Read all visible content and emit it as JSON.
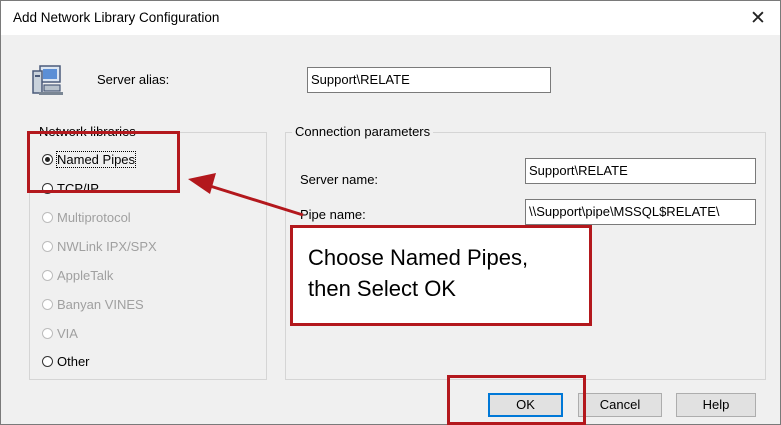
{
  "window": {
    "title": "Add Network Library Configuration",
    "close_glyph": "✕"
  },
  "alias": {
    "label": "Server alias:",
    "value": "Support\\RELATE",
    "icon": "server-computer-icon"
  },
  "libraries": {
    "caption": "Network libraries",
    "options": [
      {
        "label": "Named Pipes",
        "state": "checked"
      },
      {
        "label": "TCP/IP",
        "state": "enabled"
      },
      {
        "label": "Multiprotocol",
        "state": "disabled"
      },
      {
        "label": "NWLink IPX/SPX",
        "state": "disabled"
      },
      {
        "label": "AppleTalk",
        "state": "disabled"
      },
      {
        "label": "Banyan VINES",
        "state": "disabled"
      },
      {
        "label": "VIA",
        "state": "disabled"
      },
      {
        "label": "Other",
        "state": "enabled"
      }
    ]
  },
  "connection": {
    "caption": "Connection parameters",
    "server_name_label": "Server name:",
    "server_name_value": "Support\\RELATE",
    "pipe_name_label": "Pipe name:",
    "pipe_name_value": "\\\\Support\\pipe\\MSSQL$RELATE\\"
  },
  "annotation": {
    "line1": "Choose Named Pipes,",
    "line2": "then Select OK",
    "color": "#b3181d"
  },
  "buttons": {
    "ok": "OK",
    "cancel": "Cancel",
    "help": "Help"
  }
}
